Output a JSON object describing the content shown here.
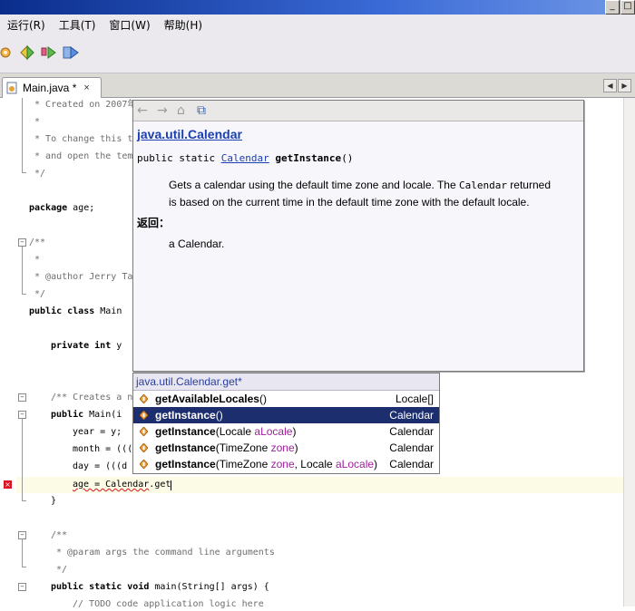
{
  "window": {
    "controls": [
      "_",
      "□"
    ]
  },
  "menubar": {
    "items": [
      "运行(R)",
      "工具(T)",
      "窗口(W)",
      "帮助(H)"
    ]
  },
  "toolbar": {
    "icons": [
      "debug-icon",
      "run-icon",
      "build-icon",
      "profile-icon"
    ]
  },
  "tab": {
    "label": "Main.java *",
    "close": "×"
  },
  "tabnav": {
    "prev": "◀",
    "next": "▶"
  },
  "code": {
    "l1": " * Created on 2007年",
    "l2": " *",
    "l3": " * To change this t",
    "l4": " * and open the tem",
    "l5": " */",
    "l6_kw": "package",
    "l6_rest": " age;",
    "l7": "/**",
    "l8": " *",
    "l9": " * @author Jerry Ta",
    "l10": " */",
    "l11_kw": "public class",
    "l11_rest": " Main",
    "l12_kw": "private int",
    "l12_rest": " y",
    "l13": "/** Creates a n",
    "l14_kw": "public",
    "l14_rest": " Main(i",
    "l15": "year = y;",
    "l16": "month = (((",
    "l17": "day = (((d",
    "l18_a": "age = Calendar",
    "l18_b": ".get",
    "l19": "}",
    "l20": "/**",
    "l21": " * @param args the command line arguments",
    "l22": " */",
    "l23_kw": "public static void",
    "l23_rest": " main(String[] args) {",
    "l24": "// TODO code application logic here"
  },
  "doc": {
    "toolbar": [
      "←",
      "→",
      "⌂",
      "⧉"
    ],
    "class_link": "java.util.Calendar",
    "sig_prefix": "public static ",
    "sig_type": "Calendar",
    "sig_method": "getInstance",
    "sig_suffix": "()",
    "desc_1": "Gets a calendar using the default time zone and locale. The ",
    "desc_code": "Calendar",
    "desc_2": " returned is based on the current time in the default time zone with the default locale.",
    "returns_heading": "返回：",
    "returns_text": "a Calendar."
  },
  "completion": {
    "header": "java.util.Calendar.get*",
    "items": [
      {
        "name": "getAvailableLocales",
        "args_open": "(",
        "p1": "",
        "p1n": "",
        "sep": "",
        "p2": "",
        "p2n": "",
        "args_close": ")",
        "type": "Locale[]"
      },
      {
        "name": "getInstance",
        "args_open": "(",
        "p1": "",
        "p1n": "",
        "sep": "",
        "p2": "",
        "p2n": "",
        "args_close": ")",
        "type": "Calendar"
      },
      {
        "name": "getInstance",
        "args_open": "(",
        "p1": "Locale ",
        "p1n": "aLocale",
        "sep": "",
        "p2": "",
        "p2n": "",
        "args_close": ")",
        "type": "Calendar"
      },
      {
        "name": "getInstance",
        "args_open": "(",
        "p1": "TimeZone ",
        "p1n": "zone",
        "sep": "",
        "p2": "",
        "p2n": "",
        "args_close": ")",
        "type": "Calendar"
      },
      {
        "name": "getInstance",
        "args_open": "(",
        "p1": "TimeZone ",
        "p1n": "zone",
        "sep": ", ",
        "p2": "Locale ",
        "p2n": "aLocale",
        "args_close": ")",
        "type": "Calendar"
      }
    ],
    "selected_index": 1
  },
  "colors": {
    "selection": "#1c2e6e",
    "link": "#1a3fb0",
    "param": "#a020a0",
    "error": "#dd1122"
  }
}
